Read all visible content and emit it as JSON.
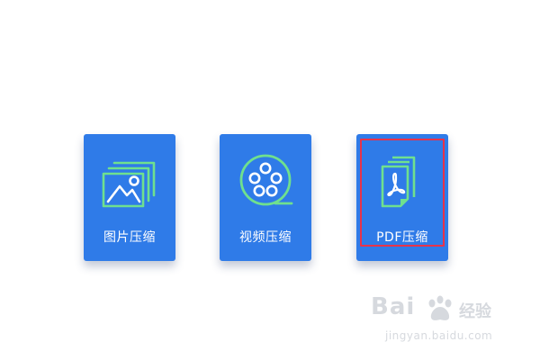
{
  "tools": [
    {
      "label": "图片压缩",
      "icon": "image-stack-icon"
    },
    {
      "label": "视频压缩",
      "icon": "film-reel-icon"
    },
    {
      "label": "PDF压缩",
      "icon": "pdf-document-icon"
    }
  ],
  "colors": {
    "card": "#2f7be8",
    "icon_stroke": "#6fe08e",
    "selection": "#e8334a"
  },
  "watermark": {
    "brand": "Bai",
    "brand_cn": "经验",
    "url": "jingyan.baidu.com"
  }
}
